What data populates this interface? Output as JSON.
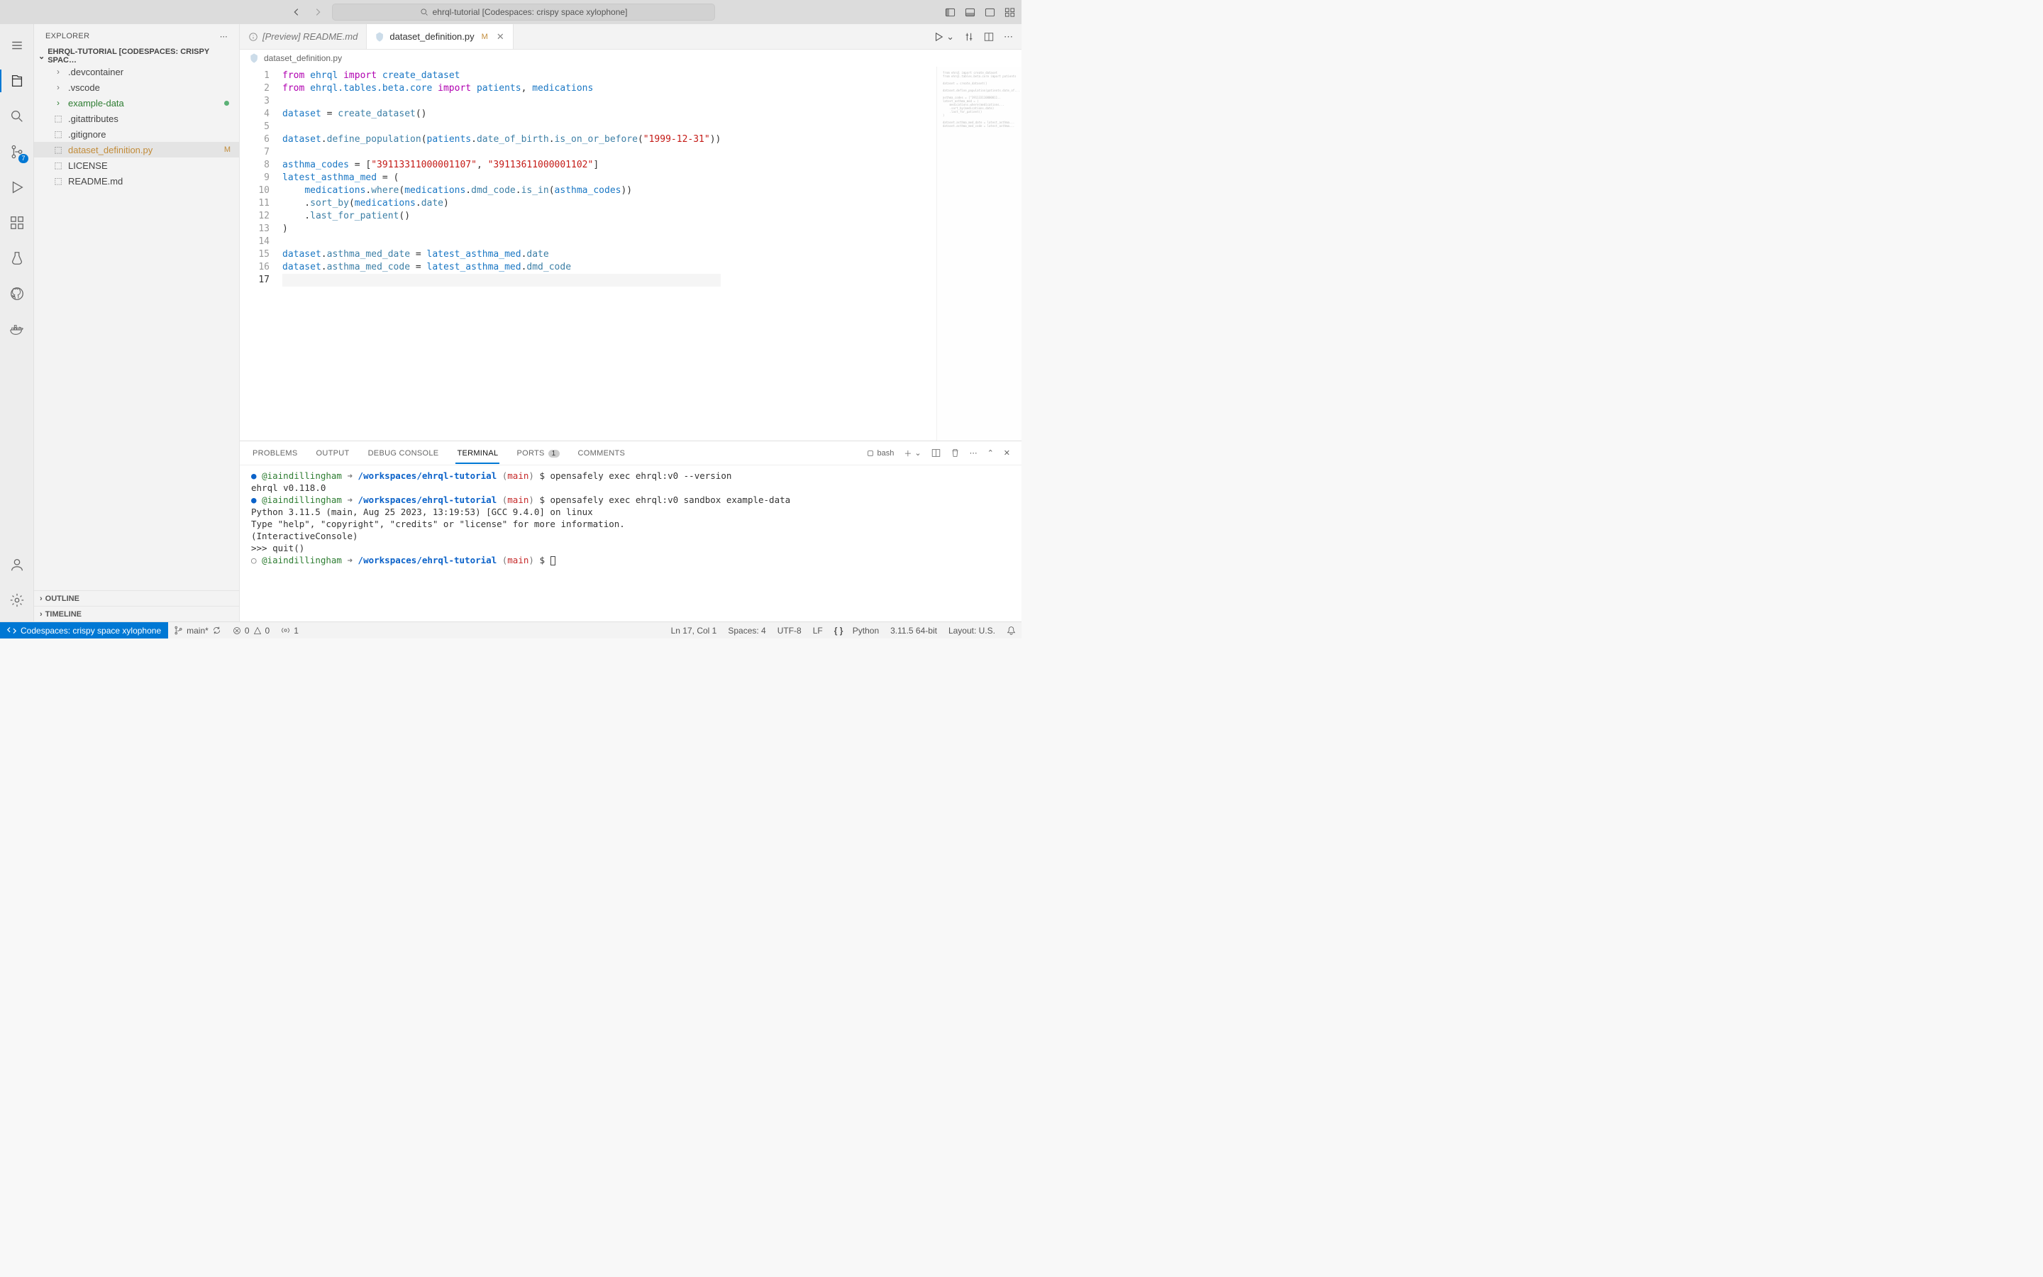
{
  "titlebar": {
    "search_text": "ehrql-tutorial [Codespaces: crispy space xylophone]"
  },
  "activitybar": {
    "scm_badge": "7"
  },
  "sidebar": {
    "title": "EXPLORER",
    "project": "EHRQL-TUTORIAL [CODESPACES: CRISPY SPAC…",
    "items": [
      {
        "name": ".devcontainer",
        "kind": "folder"
      },
      {
        "name": ".vscode",
        "kind": "folder"
      },
      {
        "name": "example-data",
        "kind": "folder",
        "dot": true,
        "green": true
      },
      {
        "name": ".gitattributes",
        "kind": "file"
      },
      {
        "name": ".gitignore",
        "kind": "file"
      },
      {
        "name": "dataset_definition.py",
        "kind": "file",
        "badge": "M",
        "active": true,
        "modified": true
      },
      {
        "name": "LICENSE",
        "kind": "file"
      },
      {
        "name": "README.md",
        "kind": "file"
      }
    ],
    "outline": "OUTLINE",
    "timeline": "TIMELINE"
  },
  "tabs": [
    {
      "label": "[Preview] README.md",
      "icon": "info"
    },
    {
      "label": "dataset_definition.py",
      "modified": "M",
      "active": true,
      "icon": "py"
    }
  ],
  "breadcrumb": "dataset_definition.py",
  "code_lines": [
    {
      "n": "1",
      "html": "<span class='kw'>from</span> <span class='mod'>ehrql</span> <span class='kw'>import</span> <span class='mod'>create_dataset</span>"
    },
    {
      "n": "2",
      "html": "<span class='kw'>from</span> <span class='mod'>ehrql.tables.beta.core</span> <span class='kw'>import</span> <span class='mod'>patients</span>, <span class='mod'>medications</span>"
    },
    {
      "n": "3",
      "html": ""
    },
    {
      "n": "4",
      "html": "<span class='mod'>dataset</span> <span class='eq'>=</span> <span class='fn'>create_dataset</span>()"
    },
    {
      "n": "5",
      "html": ""
    },
    {
      "n": "6",
      "html": "<span class='mod'>dataset</span>.<span class='fn'>define_population</span>(<span class='mod'>patients</span>.<span class='attr'>date_of_birth</span>.<span class='fn'>is_on_or_before</span>(<span class='num-str'>\"1999-12-31\"</span>))"
    },
    {
      "n": "7",
      "html": ""
    },
    {
      "n": "8",
      "html": "<span class='mod'>asthma_codes</span> <span class='eq'>=</span> [<span class='num-str'>\"39113311000001107\"</span>, <span class='num-str'>\"39113611000001102\"</span>]"
    },
    {
      "n": "9",
      "html": "<span class='mod'>latest_asthma_med</span> <span class='eq'>=</span> ("
    },
    {
      "n": "10",
      "html": "    <span class='mod'>medications</span>.<span class='fn'>where</span>(<span class='mod'>medications</span>.<span class='attr'>dmd_code</span>.<span class='fn'>is_in</span>(<span class='mod'>asthma_codes</span>))"
    },
    {
      "n": "11",
      "html": "    .<span class='fn'>sort_by</span>(<span class='mod'>medications</span>.<span class='attr'>date</span>)"
    },
    {
      "n": "12",
      "html": "    .<span class='fn'>last_for_patient</span>()"
    },
    {
      "n": "13",
      "html": ")"
    },
    {
      "n": "14",
      "html": ""
    },
    {
      "n": "15",
      "html": "<span class='mod'>dataset</span>.<span class='attr'>asthma_med_date</span> <span class='eq'>=</span> <span class='mod'>latest_asthma_med</span>.<span class='attr'>date</span>"
    },
    {
      "n": "16",
      "html": "<span class='mod'>dataset</span>.<span class='attr'>asthma_med_code</span> <span class='eq'>=</span> <span class='mod'>latest_asthma_med</span>.<span class='attr'>dmd_code</span>"
    },
    {
      "n": "17",
      "html": "",
      "active": true
    }
  ],
  "panel": {
    "tabs": {
      "problems": "PROBLEMS",
      "output": "OUTPUT",
      "debug": "DEBUG CONSOLE",
      "terminal": "TERMINAL",
      "ports": "PORTS",
      "ports_count": "1",
      "comments": "COMMENTS"
    },
    "shell": "bash",
    "lines": [
      "● @iaindillingham ➜ /workspaces/ehrql-tutorial (main) $ opensafely exec ehrql:v0 --version",
      "  ehrql v0.118.0",
      "● @iaindillingham ➜ /workspaces/ehrql-tutorial (main) $ opensafely exec ehrql:v0 sandbox example-data",
      "  Python 3.11.5 (main, Aug 25 2023, 13:19:53) [GCC 9.4.0] on linux",
      "  Type \"help\", \"copyright\", \"credits\" or \"license\" for more information.",
      "  (InteractiveConsole)",
      "  >>> quit()",
      "○ @iaindillingham ➜ /workspaces/ehrql-tutorial (main) $ "
    ]
  },
  "statusbar": {
    "remote": "Codespaces: crispy space xylophone",
    "branch": "main*",
    "errors": "0",
    "warnings": "0",
    "ports": "1",
    "cursor": "Ln 17, Col 1",
    "spaces": "Spaces: 4",
    "encoding": "UTF-8",
    "eol": "LF",
    "lang": "Python",
    "runtime": "3.11.5 64-bit",
    "layout": "Layout: U.S."
  }
}
